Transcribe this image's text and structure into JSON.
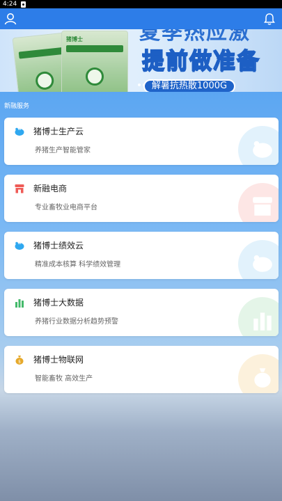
{
  "status_bar": {
    "time": "4:24"
  },
  "banner": {
    "title_line1": "夏季热应激",
    "title_line2": "提前做准备",
    "pill": "解暑抗热散1000G",
    "package_brand": "猪博士"
  },
  "section": {
    "label": "新融服务"
  },
  "services": [
    {
      "title": "猪博士生产云",
      "subtitle": "养猪生产智能管家",
      "icon": "piggy-bank-icon",
      "color": "#2fa8f0"
    },
    {
      "title": "新融电商",
      "subtitle": "专业畜牧业电商平台",
      "icon": "shop-icon",
      "color": "#ef5b56"
    },
    {
      "title": "猪博士绩效云",
      "subtitle": "精准成本核算 科学绩效管理",
      "icon": "piggy-bank-icon",
      "color": "#2fa8f0"
    },
    {
      "title": "猪博士大数据",
      "subtitle": "养猪行业数据分析趋势预警",
      "icon": "bar-chart-icon",
      "color": "#43b96a"
    },
    {
      "title": "猪博士物联网",
      "subtitle": "智能畜牧 高效生产",
      "icon": "money-bag-icon",
      "color": "#e6a92a"
    }
  ]
}
